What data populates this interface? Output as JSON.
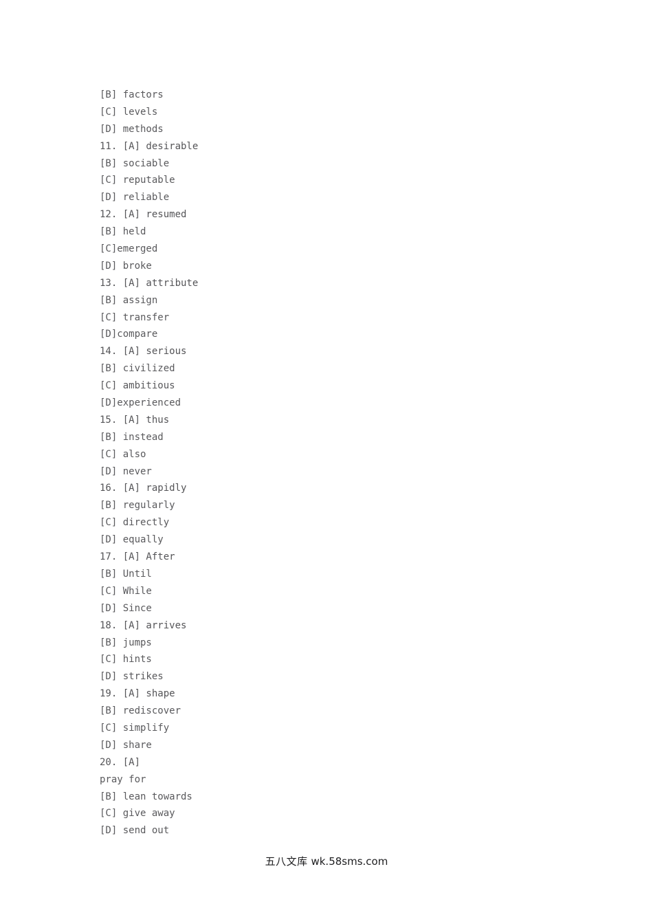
{
  "document": {
    "background_color": "#ffffff",
    "text_color": "#59595c",
    "lines": [
      {
        "id": "line-1",
        "text": "[B] factors",
        "type": "option"
      },
      {
        "id": "line-2",
        "text": "[C] levels",
        "type": "option"
      },
      {
        "id": "line-3",
        "text": "[D] methods",
        "type": "option"
      },
      {
        "id": "line-4",
        "text": "11. [A] desirable",
        "type": "numbered"
      },
      {
        "id": "line-5",
        "text": "[B] sociable",
        "type": "option"
      },
      {
        "id": "line-6",
        "text": "[C] reputable",
        "type": "option"
      },
      {
        "id": "line-7",
        "text": "[D] reliable",
        "type": "option"
      },
      {
        "id": "line-8",
        "text": "12. [A] resumed",
        "type": "numbered"
      },
      {
        "id": "line-9",
        "text": "[B] held",
        "type": "option"
      },
      {
        "id": "line-10",
        "text": "[C]emerged",
        "type": "option"
      },
      {
        "id": "line-11",
        "text": "[D] broke",
        "type": "option"
      },
      {
        "id": "line-12",
        "text": "13. [A] attribute",
        "type": "numbered"
      },
      {
        "id": "line-13",
        "text": "[B] assign",
        "type": "option"
      },
      {
        "id": "line-14",
        "text": "[C] transfer",
        "type": "option"
      },
      {
        "id": "line-15",
        "text": "[D]compare",
        "type": "option"
      },
      {
        "id": "line-16",
        "text": "14. [A] serious",
        "type": "numbered"
      },
      {
        "id": "line-17",
        "text": "[B] civilized",
        "type": "option"
      },
      {
        "id": "line-18",
        "text": "[C] ambitious",
        "type": "option"
      },
      {
        "id": "line-19",
        "text": "[D]experienced",
        "type": "option"
      },
      {
        "id": "line-20",
        "text": "15. [A] thus",
        "type": "numbered"
      },
      {
        "id": "line-21",
        "text": "[B] instead",
        "type": "option"
      },
      {
        "id": "line-22",
        "text": "[C] also",
        "type": "option"
      },
      {
        "id": "line-23",
        "text": "[D] never",
        "type": "option"
      },
      {
        "id": "line-24",
        "text": "16. [A] rapidly",
        "type": "numbered"
      },
      {
        "id": "line-25",
        "text": "[B] regularly",
        "type": "option"
      },
      {
        "id": "line-26",
        "text": "[C] directly",
        "type": "option"
      },
      {
        "id": "line-27",
        "text": "[D] equally",
        "type": "option"
      },
      {
        "id": "line-28",
        "text": "17. [A] After",
        "type": "numbered"
      },
      {
        "id": "line-29",
        "text": "[B] Until",
        "type": "option"
      },
      {
        "id": "line-30",
        "text": "[C] While",
        "type": "option"
      },
      {
        "id": "line-31",
        "text": "[D] Since",
        "type": "option"
      },
      {
        "id": "line-32",
        "text": "18. [A] arrives",
        "type": "numbered"
      },
      {
        "id": "line-33",
        "text": "[B] jumps",
        "type": "option"
      },
      {
        "id": "line-34",
        "text": "[C] hints",
        "type": "option"
      },
      {
        "id": "line-35",
        "text": "[D] strikes",
        "type": "option"
      },
      {
        "id": "line-36",
        "text": "19. [A] shape",
        "type": "numbered"
      },
      {
        "id": "line-37",
        "text": "[B] rediscover",
        "type": "option"
      },
      {
        "id": "line-38",
        "text": "[C] simplify",
        "type": "option"
      },
      {
        "id": "line-39",
        "text": "[D] share",
        "type": "option"
      },
      {
        "id": "line-40",
        "text": "20. [A]",
        "type": "numbered"
      },
      {
        "id": "line-41",
        "text": "pray for",
        "type": "option"
      },
      {
        "id": "line-42",
        "text": "[B] lean towards",
        "type": "option"
      },
      {
        "id": "line-43",
        "text": "[C] give away",
        "type": "option"
      },
      {
        "id": "line-44",
        "text": "[D] send out",
        "type": "option"
      }
    ]
  },
  "footer": {
    "watermark_cn": "五八文库",
    "watermark_url": "wk.58sms.com",
    "color": "#1d1d1f"
  }
}
